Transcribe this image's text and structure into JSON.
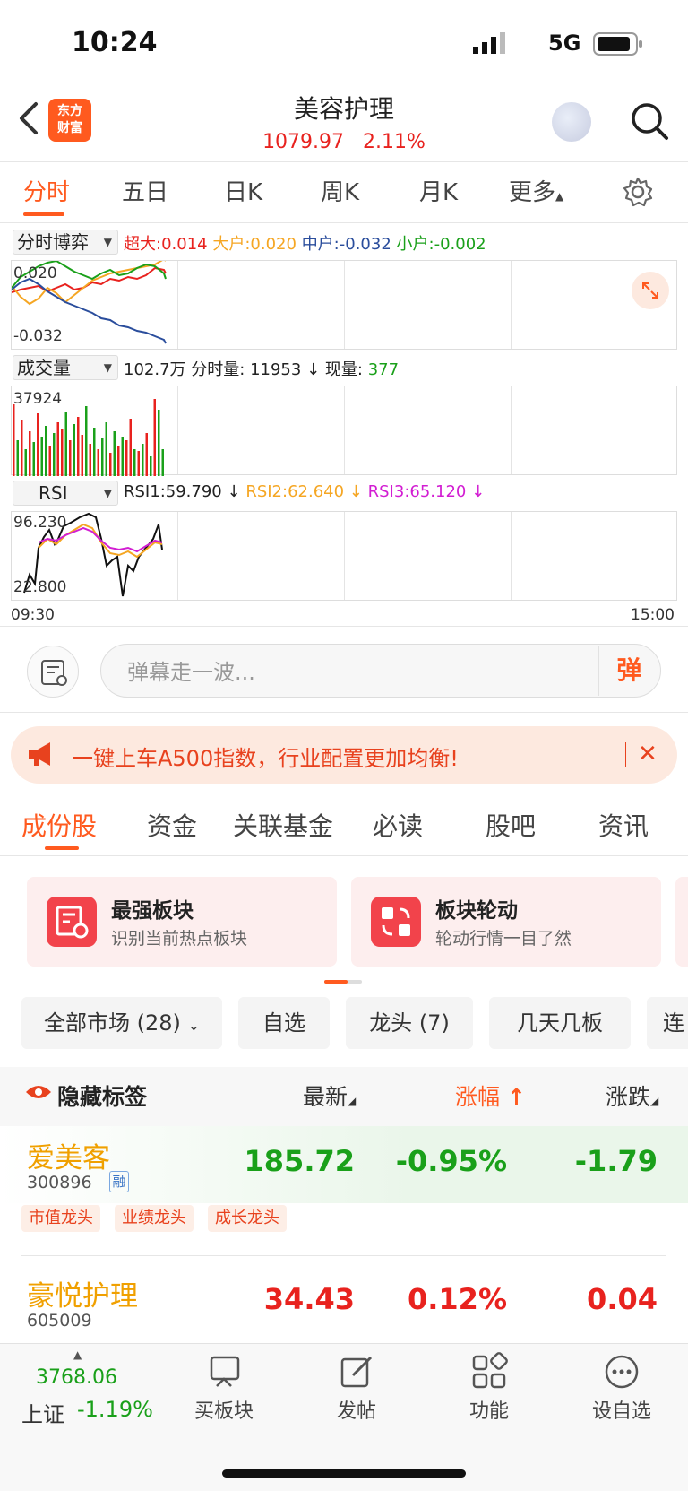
{
  "status": {
    "time": "10:24",
    "network": "5G"
  },
  "header": {
    "logo_line1": "东方",
    "logo_line2": "财富",
    "title": "美容护理",
    "price": "1079.97",
    "change_pct": "2.11%"
  },
  "timeframe_tabs": [
    "分时",
    "五日",
    "日K",
    "周K",
    "月K",
    "更多"
  ],
  "panel_fund": {
    "selector": "分时博弈",
    "super_label": "超大:",
    "super_val": "0.014",
    "large_label": "大户:",
    "large_val": "0.020",
    "mid_label": "中户:",
    "mid_val": "-0.032",
    "small_label": "小户:",
    "small_val": "-0.002",
    "y_top": "0.020",
    "y_bottom": "-0.032"
  },
  "panel_volume": {
    "selector": "成交量",
    "total": "102.7万",
    "minute_label": "分时量:",
    "minute_val": "11953",
    "current_label": "现量:",
    "current_val": "377",
    "y_top": "37924"
  },
  "panel_rsi": {
    "selector": "RSI",
    "rsi1": "RSI1:59.790",
    "rsi2": "RSI2:62.640",
    "rsi3": "RSI3:65.120",
    "y_top": "96.230",
    "y_bottom": "22.800",
    "x_start": "09:30",
    "x_end": "15:00"
  },
  "danmu": {
    "placeholder": "弹幕走一波...",
    "send": "弹"
  },
  "banner": {
    "text": "一键上车A500指数，行业配置更加均衡!"
  },
  "section_tabs": [
    "成份股",
    "资金",
    "关联基金",
    "必读",
    "股吧",
    "资讯"
  ],
  "cards": [
    {
      "title": "最强板块",
      "subtitle": "识别当前热点板块"
    },
    {
      "title": "板块轮动",
      "subtitle": "轮动行情一目了然"
    }
  ],
  "chips": [
    "全部市场 (28)",
    "自选",
    "龙头 (7)",
    "几天几板",
    "连"
  ],
  "table": {
    "hide_tags": "隐藏标签",
    "col_latest": "最新",
    "col_change_pct": "涨幅",
    "col_change": "涨跌"
  },
  "rows": [
    {
      "name": "爱美客",
      "code": "300896",
      "badge": "融",
      "price": "185.72",
      "pct": "-0.95%",
      "chg": "-1.79",
      "tags": [
        "市值龙头",
        "业绩龙头",
        "成长龙头"
      ]
    },
    {
      "name": "豪悦护理",
      "code": "605009",
      "price": "34.43",
      "pct": "0.12%",
      "chg": "0.04"
    }
  ],
  "bottom": {
    "index_value": "3768.06",
    "index_name": "上证",
    "index_change": "-1.19%",
    "nav": [
      "买板块",
      "发帖",
      "功能",
      "设自选"
    ]
  },
  "colors": {
    "accent": "#ff5a1f",
    "up": "#e8221e",
    "down": "#1aa01a"
  }
}
